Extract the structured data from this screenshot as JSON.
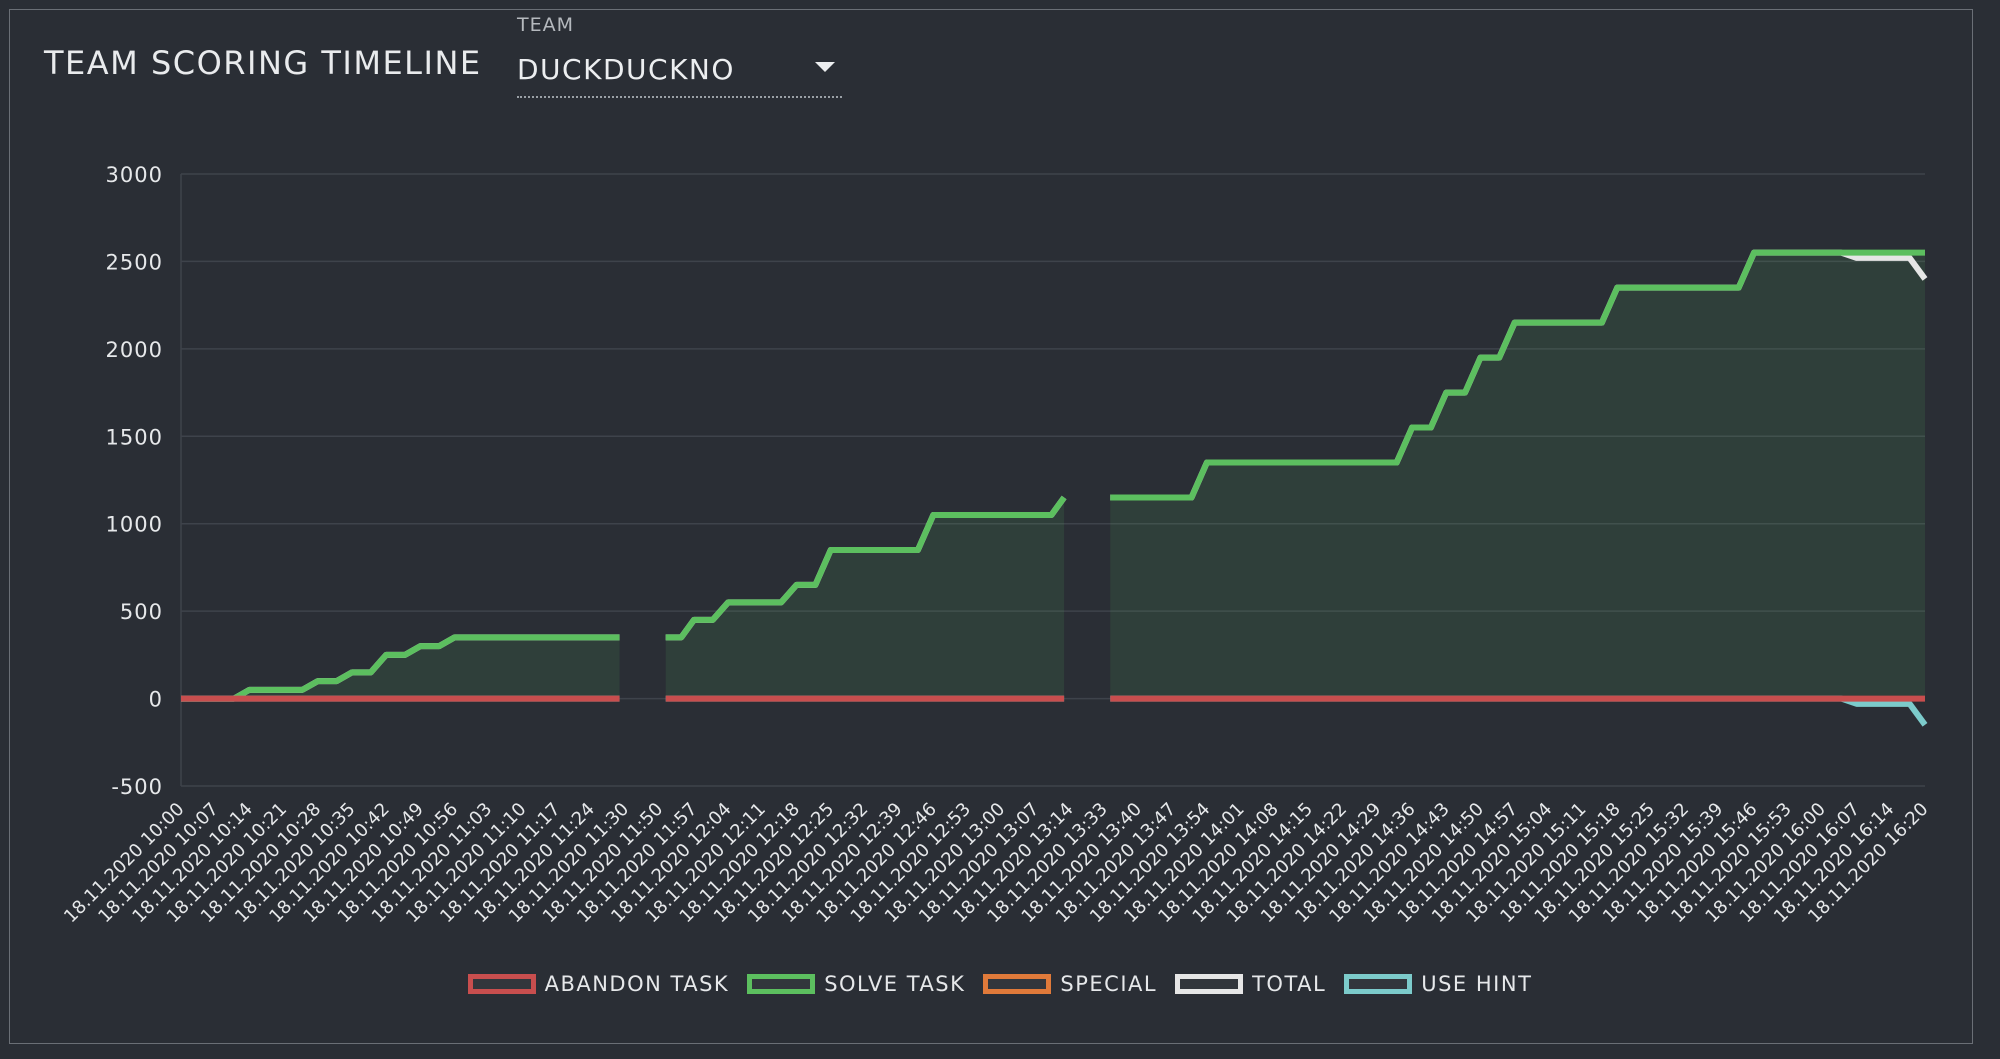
{
  "header": {
    "title": "TEAM SCORING TIMELINE",
    "team_label": "TEAM",
    "team_value": "DUCKDUCKNO"
  },
  "colors": {
    "background": "#2a2e35",
    "abandon": "#c84e4e",
    "solve": "#5cbf5f",
    "special": "#e07a3a",
    "total": "#e6e6e6",
    "hint": "#7ccbcb"
  },
  "chart_data": {
    "type": "line",
    "title": "TEAM SCORING TIMELINE",
    "xlabel": "",
    "ylabel": "",
    "ylim": [
      -500,
      3000
    ],
    "y_ticks": [
      3000,
      2500,
      2000,
      1500,
      1000,
      500,
      0,
      -500
    ],
    "grid": true,
    "legend_position": "bottom",
    "x": [
      "18.11.2020 10:00",
      "18.11.2020 10:07",
      "18.11.2020 10:14",
      "18.11.2020 10:21",
      "18.11.2020 10:28",
      "18.11.2020 10:35",
      "18.11.2020 10:42",
      "18.11.2020 10:49",
      "18.11.2020 10:56",
      "18.11.2020 11:03",
      "18.11.2020 11:10",
      "18.11.2020 11:17",
      "18.11.2020 11:24",
      "18.11.2020 11:30",
      "18.11.2020 11:50",
      "18.11.2020 11:57",
      "18.11.2020 12:04",
      "18.11.2020 12:11",
      "18.11.2020 12:18",
      "18.11.2020 12:25",
      "18.11.2020 12:32",
      "18.11.2020 12:39",
      "18.11.2020 12:46",
      "18.11.2020 12:53",
      "18.11.2020 13:00",
      "18.11.2020 13:07",
      "18.11.2020 13:14",
      "18.11.2020 13:33",
      "18.11.2020 13:40",
      "18.11.2020 13:47",
      "18.11.2020 13:54",
      "18.11.2020 14:01",
      "18.11.2020 14:08",
      "18.11.2020 14:15",
      "18.11.2020 14:22",
      "18.11.2020 14:29",
      "18.11.2020 14:36",
      "18.11.2020 14:43",
      "18.11.2020 14:50",
      "18.11.2020 14:57",
      "18.11.2020 15:04",
      "18.11.2020 15:11",
      "18.11.2020 15:18",
      "18.11.2020 15:25",
      "18.11.2020 15:32",
      "18.11.2020 15:39",
      "18.11.2020 15:46",
      "18.11.2020 15:53",
      "18.11.2020 16:00",
      "18.11.2020 16:07",
      "18.11.2020 16:14",
      "18.11.2020 16:20"
    ],
    "gaps_after_index": [
      13,
      26
    ],
    "series": [
      {
        "name": "ABANDON TASK",
        "color": "#c84e4e",
        "values": [
          0,
          0,
          0,
          0,
          0,
          0,
          0,
          0,
          0,
          0,
          0,
          0,
          0,
          0,
          0,
          0,
          0,
          0,
          0,
          0,
          0,
          0,
          0,
          0,
          0,
          0,
          0,
          0,
          0,
          0,
          0,
          0,
          0,
          0,
          0,
          0,
          0,
          0,
          0,
          0,
          0,
          0,
          0,
          0,
          0,
          0,
          0,
          0,
          0,
          0,
          0,
          0
        ]
      },
      {
        "name": "SOLVE TASK",
        "color": "#5cbf5f",
        "values": [
          0,
          0,
          50,
          50,
          100,
          150,
          250,
          300,
          350,
          350,
          350,
          350,
          350,
          350,
          350,
          450,
          550,
          550,
          650,
          850,
          850,
          850,
          1050,
          1050,
          1050,
          1050,
          1150,
          1150,
          1150,
          1150,
          1350,
          1350,
          1350,
          1350,
          1350,
          1350,
          1550,
          1750,
          1950,
          2150,
          2150,
          2150,
          2350,
          2350,
          2350,
          2350,
          2550,
          2550,
          2550,
          2550,
          2550,
          2550
        ]
      },
      {
        "name": "SPECIAL",
        "color": "#e07a3a",
        "values": []
      },
      {
        "name": "TOTAL",
        "color": "#e6e6e6",
        "values": [
          0,
          0,
          50,
          50,
          100,
          150,
          250,
          300,
          350,
          350,
          350,
          350,
          350,
          350,
          350,
          450,
          550,
          550,
          650,
          850,
          850,
          850,
          1050,
          1050,
          1050,
          1050,
          1150,
          1150,
          1150,
          1150,
          1350,
          1350,
          1350,
          1350,
          1350,
          1350,
          1550,
          1750,
          1950,
          2150,
          2150,
          2150,
          2350,
          2350,
          2350,
          2350,
          2550,
          2550,
          2550,
          2520,
          2520,
          2400
        ]
      },
      {
        "name": "USE HINT",
        "color": "#7ccbcb",
        "values": [
          0,
          0,
          0,
          0,
          0,
          0,
          0,
          0,
          0,
          0,
          0,
          0,
          0,
          0,
          0,
          0,
          0,
          0,
          0,
          0,
          0,
          0,
          0,
          0,
          0,
          0,
          0,
          0,
          0,
          0,
          0,
          0,
          0,
          0,
          0,
          0,
          0,
          0,
          0,
          0,
          0,
          0,
          0,
          0,
          0,
          0,
          0,
          0,
          0,
          -30,
          -30,
          -150
        ]
      }
    ]
  },
  "legend": {
    "items": [
      {
        "label": "ABANDON TASK",
        "color": "#c84e4e"
      },
      {
        "label": "SOLVE TASK",
        "color": "#5cbf5f"
      },
      {
        "label": "SPECIAL",
        "color": "#e07a3a"
      },
      {
        "label": "TOTAL",
        "color": "#e6e6e6"
      },
      {
        "label": "USE HINT",
        "color": "#7ccbcb"
      }
    ]
  }
}
